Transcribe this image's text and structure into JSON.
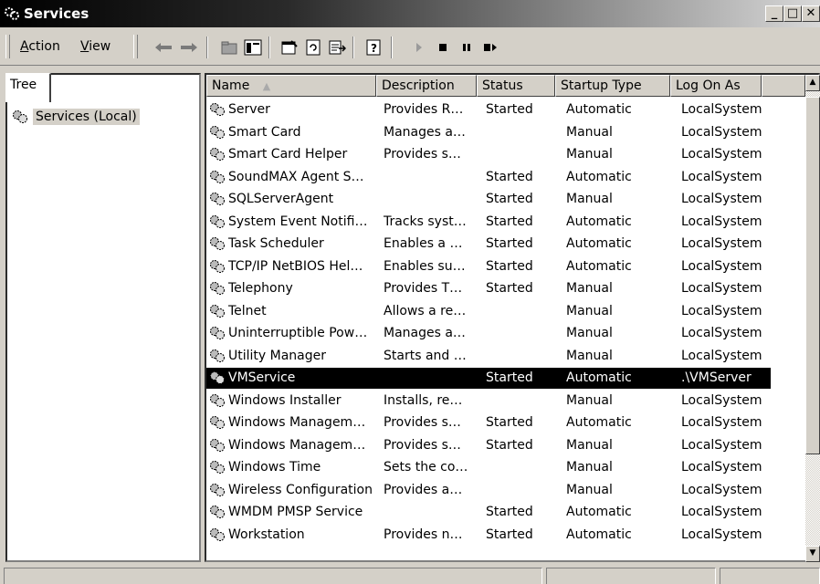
{
  "window": {
    "title": "Services",
    "minimize_label": "_",
    "maximize_label": "□",
    "close_label": "✕"
  },
  "menu": {
    "action_first": "A",
    "action_rest": "ction",
    "view_first": "V",
    "view_rest": "iew"
  },
  "toolbar": {
    "icons": [
      "back-arrow-icon",
      "forward-arrow-icon",
      "up-folder-icon",
      "show-hide-tree-icon",
      "properties-icon",
      "refresh-icon",
      "export-list-icon",
      "help-icon",
      "start-service-icon",
      "stop-service-icon",
      "pause-service-icon",
      "restart-service-icon"
    ]
  },
  "tree": {
    "tab_label": "Tree",
    "root_label": "Services (Local)"
  },
  "list": {
    "columns": [
      "Name",
      "Description",
      "Status",
      "Startup Type",
      "Log On As"
    ],
    "sort_indicator": "▲",
    "rows": [
      {
        "name": "Server",
        "description": "Provides R…",
        "status": "Started",
        "startup": "Automatic",
        "logon": "LocalSystem"
      },
      {
        "name": "Smart Card",
        "description": "Manages a…",
        "status": "",
        "startup": "Manual",
        "logon": "LocalSystem"
      },
      {
        "name": "Smart Card Helper",
        "description": "Provides s…",
        "status": "",
        "startup": "Manual",
        "logon": "LocalSystem"
      },
      {
        "name": "SoundMAX Agent S…",
        "description": "",
        "status": "Started",
        "startup": "Automatic",
        "logon": "LocalSystem"
      },
      {
        "name": "SQLServerAgent",
        "description": "",
        "status": "Started",
        "startup": "Manual",
        "logon": "LocalSystem"
      },
      {
        "name": "System Event Notifi…",
        "description": "Tracks syst…",
        "status": "Started",
        "startup": "Automatic",
        "logon": "LocalSystem"
      },
      {
        "name": "Task Scheduler",
        "description": "Enables a …",
        "status": "Started",
        "startup": "Automatic",
        "logon": "LocalSystem"
      },
      {
        "name": "TCP/IP NetBIOS Hel…",
        "description": "Enables su…",
        "status": "Started",
        "startup": "Automatic",
        "logon": "LocalSystem"
      },
      {
        "name": "Telephony",
        "description": "Provides T…",
        "status": "Started",
        "startup": "Manual",
        "logon": "LocalSystem"
      },
      {
        "name": "Telnet",
        "description": "Allows a re…",
        "status": "",
        "startup": "Manual",
        "logon": "LocalSystem"
      },
      {
        "name": "Uninterruptible Pow…",
        "description": "Manages a…",
        "status": "",
        "startup": "Manual",
        "logon": "LocalSystem"
      },
      {
        "name": "Utility Manager",
        "description": "Starts and …",
        "status": "",
        "startup": "Manual",
        "logon": "LocalSystem"
      },
      {
        "name": "VMService",
        "description": "",
        "status": "Started",
        "startup": "Automatic",
        "logon": ".\\VMServer",
        "selected": true
      },
      {
        "name": "Windows Installer",
        "description": "Installs, re…",
        "status": "",
        "startup": "Manual",
        "logon": "LocalSystem"
      },
      {
        "name": "Windows Managem…",
        "description": "Provides s…",
        "status": "Started",
        "startup": "Automatic",
        "logon": "LocalSystem"
      },
      {
        "name": "Windows Managem…",
        "description": "Provides s…",
        "status": "Started",
        "startup": "Manual",
        "logon": "LocalSystem"
      },
      {
        "name": "Windows Time",
        "description": "Sets the co…",
        "status": "",
        "startup": "Manual",
        "logon": "LocalSystem"
      },
      {
        "name": "Wireless Configuration",
        "description": "Provides a…",
        "status": "",
        "startup": "Manual",
        "logon": "LocalSystem"
      },
      {
        "name": "WMDM PMSP Service",
        "description": "",
        "status": "Started",
        "startup": "Automatic",
        "logon": "LocalSystem"
      },
      {
        "name": "Workstation",
        "description": "Provides n…",
        "status": "Started",
        "startup": "Automatic",
        "logon": "LocalSystem"
      }
    ]
  },
  "colors": {
    "face": "#d4d0c8",
    "selection": "#000000",
    "title_start": "#000000",
    "title_end": "#d8d8d8"
  }
}
